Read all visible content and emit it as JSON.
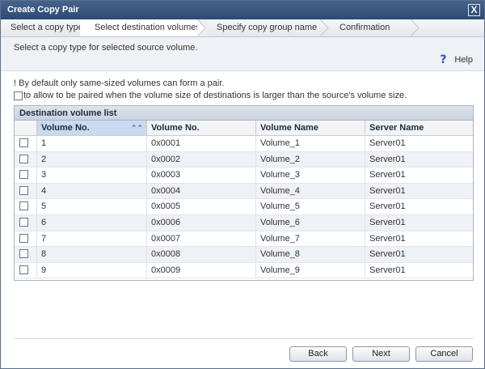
{
  "window": {
    "title": "Create Copy Pair",
    "close_label": "X"
  },
  "steps": [
    {
      "label": "Select a copy type",
      "active": false
    },
    {
      "label": "Select destination volumes",
      "active": true
    },
    {
      "label": "Specify copy group name",
      "active": false
    },
    {
      "label": "Confirmation",
      "active": false
    }
  ],
  "instruction": "Select a copy type for selected source volume.",
  "help": {
    "label": "Help",
    "icon": "question-icon"
  },
  "note": "! By default only same-sized volumes can form a pair.",
  "allow_option": {
    "label": "to allow to be paired when the volume size of destinations is larger than the source's volume size.",
    "checked": false
  },
  "volume_list": {
    "title": "Destination volume list",
    "columns": [
      "Volume No.",
      "Volume No.",
      "Volume Name",
      "Server Name"
    ],
    "sorted_column": 0,
    "rows": [
      {
        "no": "1",
        "hex": "0x0001",
        "name": "Volume_1",
        "server": "Server01"
      },
      {
        "no": "2",
        "hex": "0x0002",
        "name": "Volume_2",
        "server": "Server01"
      },
      {
        "no": "3",
        "hex": "0x0003",
        "name": "Volume_3",
        "server": "Server01"
      },
      {
        "no": "4",
        "hex": "0x0004",
        "name": "Volume_4",
        "server": "Server01"
      },
      {
        "no": "5",
        "hex": "0x0005",
        "name": "Volume_5",
        "server": "Server01"
      },
      {
        "no": "6",
        "hex": "0x0006",
        "name": "Volume_6",
        "server": "Server01"
      },
      {
        "no": "7",
        "hex": "0x0007",
        "name": "Volume_7",
        "server": "Server01"
      },
      {
        "no": "8",
        "hex": "0x0008",
        "name": "Volume_8",
        "server": "Server01"
      },
      {
        "no": "9",
        "hex": "0x0009",
        "name": "Volume_9",
        "server": "Server01"
      }
    ]
  },
  "buttons": {
    "back": "Back",
    "next": "Next",
    "cancel": "Cancel"
  }
}
